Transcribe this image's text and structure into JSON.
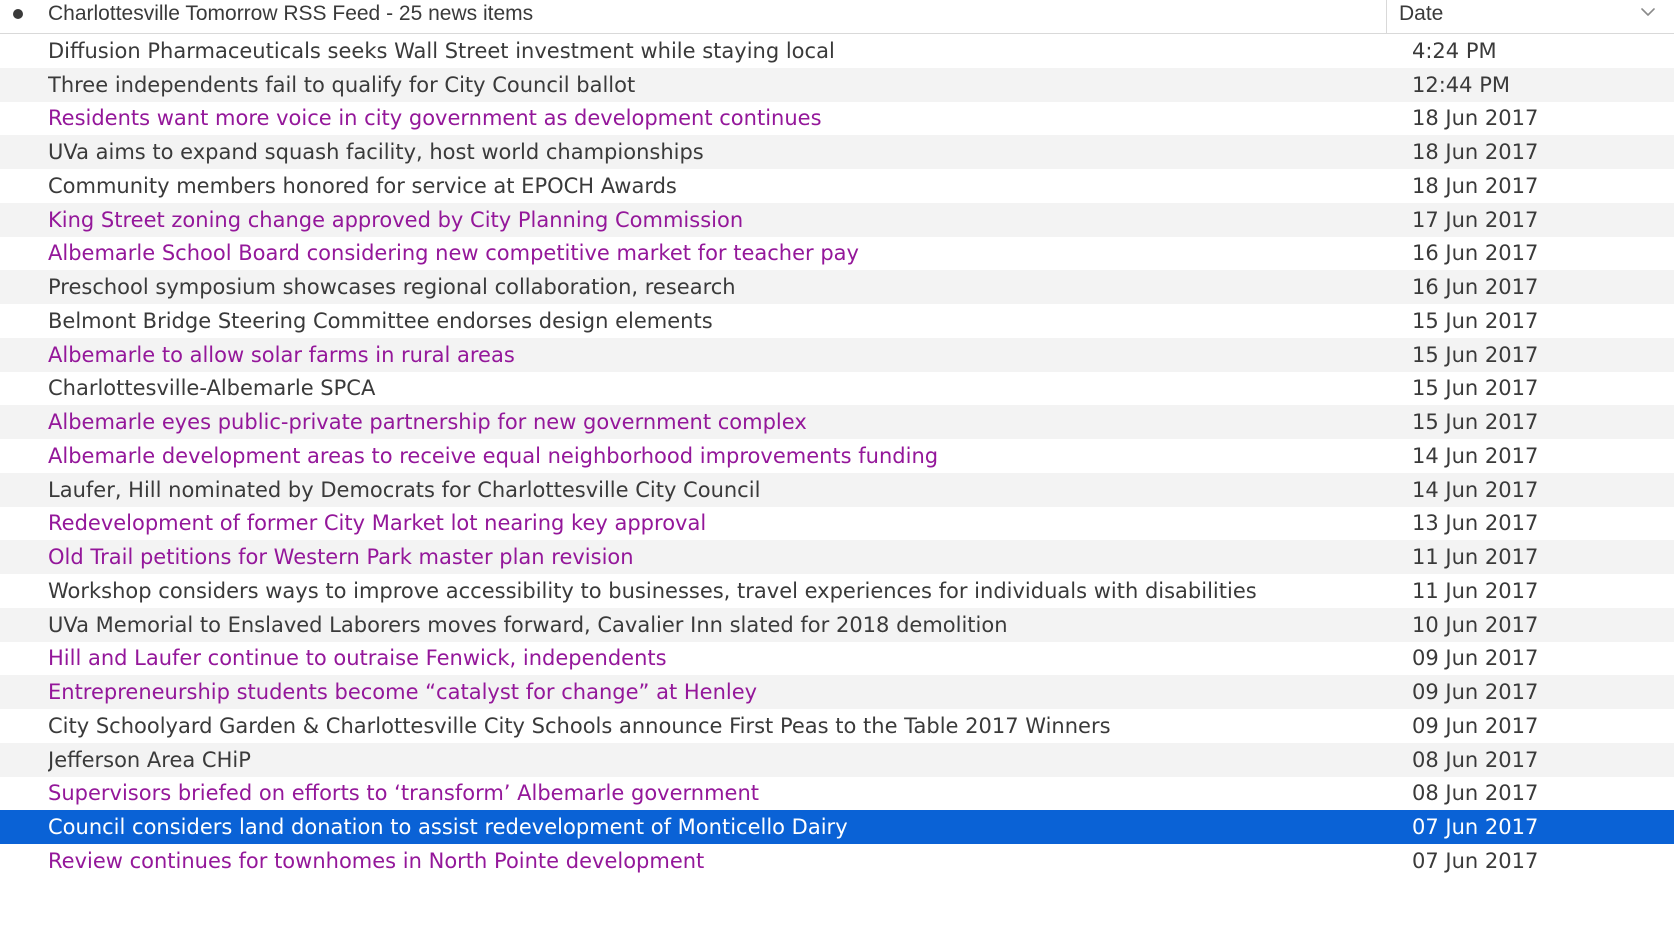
{
  "header": {
    "feed_title": "Charlottesville Tomorrow RSS Feed - 25 news items",
    "date_column": "Date",
    "status_icon": "unread-dot-icon",
    "sort_icon": "chevron-down-icon"
  },
  "colors": {
    "unread_text": "#94179a",
    "read_text": "#3a3a3a",
    "selected_bg": "#0a62d6",
    "alt_row_bg": "#f3f3f3"
  },
  "items": [
    {
      "title": "Diffusion Pharmaceuticals seeks Wall Street investment while staying local",
      "date": "4:24 PM",
      "unread": false,
      "selected": false
    },
    {
      "title": "Three independents fail to qualify for City Council ballot",
      "date": "12:44 PM",
      "unread": false,
      "selected": false
    },
    {
      "title": "Residents want more voice in city government as development continues",
      "date": "18 Jun 2017",
      "unread": true,
      "selected": false
    },
    {
      "title": "UVa aims to expand squash facility, host world championships",
      "date": "18 Jun 2017",
      "unread": false,
      "selected": false
    },
    {
      "title": "Community members honored for service at EPOCH Awards",
      "date": "18 Jun 2017",
      "unread": false,
      "selected": false
    },
    {
      "title": "King Street zoning change approved by City Planning Commission",
      "date": "17 Jun 2017",
      "unread": true,
      "selected": false
    },
    {
      "title": "Albemarle School Board considering new competitive market for teacher pay",
      "date": "16 Jun 2017",
      "unread": true,
      "selected": false
    },
    {
      "title": "Preschool symposium showcases regional collaboration, research",
      "date": "16 Jun 2017",
      "unread": false,
      "selected": false
    },
    {
      "title": "Belmont Bridge Steering Committee endorses design elements",
      "date": "15 Jun 2017",
      "unread": false,
      "selected": false
    },
    {
      "title": "Albemarle to allow solar farms in rural areas",
      "date": "15 Jun 2017",
      "unread": true,
      "selected": false
    },
    {
      "title": "Charlottesville-Albemarle SPCA",
      "date": "15 Jun 2017",
      "unread": false,
      "selected": false
    },
    {
      "title": "Albemarle eyes public-private partnership for new government complex",
      "date": "15 Jun 2017",
      "unread": true,
      "selected": false
    },
    {
      "title": "Albemarle development areas to receive equal neighborhood improvements funding",
      "date": "14 Jun 2017",
      "unread": true,
      "selected": false
    },
    {
      "title": "Laufer, Hill nominated by Democrats for Charlottesville City Council",
      "date": "14 Jun 2017",
      "unread": false,
      "selected": false
    },
    {
      "title": "Redevelopment of former City Market lot nearing key approval",
      "date": "13 Jun 2017",
      "unread": true,
      "selected": false
    },
    {
      "title": "Old Trail petitions for Western Park master plan revision",
      "date": "11 Jun 2017",
      "unread": true,
      "selected": false
    },
    {
      "title": "Workshop considers ways to improve accessibility to businesses, travel experiences for individuals with disabilities",
      "date": "11 Jun 2017",
      "unread": false,
      "selected": false
    },
    {
      "title": "UVa Memorial to Enslaved Laborers moves forward, Cavalier Inn slated for 2018 demolition",
      "date": "10 Jun 2017",
      "unread": false,
      "selected": false
    },
    {
      "title": "Hill and Laufer continue to outraise Fenwick, independents",
      "date": "09 Jun 2017",
      "unread": true,
      "selected": false
    },
    {
      "title": "Entrepreneurship students become “catalyst for change” at Henley",
      "date": "09 Jun 2017",
      "unread": true,
      "selected": false
    },
    {
      "title": "City Schoolyard Garden & Charlottesville City Schools announce First Peas to the Table 2017 Winners",
      "date": "09 Jun 2017",
      "unread": false,
      "selected": false
    },
    {
      "title": "Jefferson Area CHiP",
      "date": "08 Jun 2017",
      "unread": false,
      "selected": false
    },
    {
      "title": "Supervisors briefed on efforts to ‘transform’ Albemarle government",
      "date": "08 Jun 2017",
      "unread": true,
      "selected": false
    },
    {
      "title": "Council considers land donation to assist redevelopment of Monticello Dairy",
      "date": "07 Jun 2017",
      "unread": false,
      "selected": true
    },
    {
      "title": "Review continues for townhomes in North Pointe development",
      "date": "07 Jun 2017",
      "unread": true,
      "selected": false
    }
  ]
}
